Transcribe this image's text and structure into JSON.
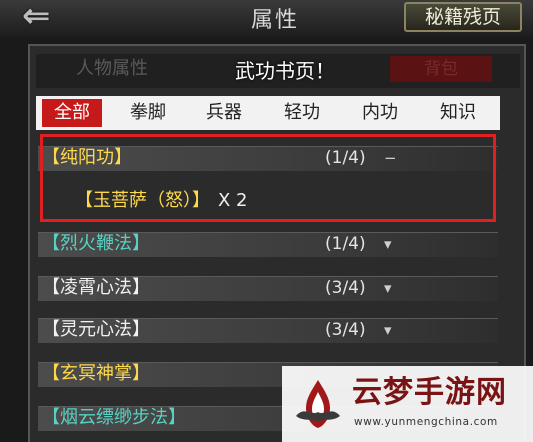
{
  "header": {
    "title": "属性",
    "back_glyph": "⇐",
    "secret_pages_button": "秘籍残页"
  },
  "background_tabs": {
    "left": "人物属性",
    "right": "背包"
  },
  "toast": "武功书页！",
  "tabs": [
    {
      "label": "全部",
      "active": true
    },
    {
      "label": "拳脚",
      "active": false
    },
    {
      "label": "兵器",
      "active": false
    },
    {
      "label": "轻功",
      "active": false
    },
    {
      "label": "内功",
      "active": false
    },
    {
      "label": "知识",
      "active": false
    }
  ],
  "skills": [
    {
      "name": "【纯阳功】",
      "count": "(1/4)",
      "toggle": "−",
      "color": "#ffd94a"
    },
    {
      "name": "【烈火鞭法】",
      "count": "(1/4)",
      "toggle": "▾",
      "color": "#58d2c4"
    },
    {
      "name": "【凌霄心法】",
      "count": "(3/4)",
      "toggle": "▾",
      "color": "#f2f2f2"
    },
    {
      "name": "【灵元心法】",
      "count": "(3/4)",
      "toggle": "▾",
      "color": "#f2f2f2"
    },
    {
      "name": "【玄冥神掌】",
      "count": "",
      "toggle": "",
      "color": "#ffd94a"
    },
    {
      "name": "【烟云缥缈步法】",
      "count": "",
      "toggle": "",
      "color": "#58d2c4"
    }
  ],
  "expanded_item": {
    "name": "【玉菩萨（怒）】",
    "quantity": "X 2"
  },
  "watermark": {
    "title": "云梦手游网",
    "url": "www.yunmengchina.com"
  },
  "colors": {
    "active_tab": "#c61a1a",
    "highlight_box": "#e02020",
    "gold_text": "#ffd94a",
    "teal_text": "#58d2c4"
  }
}
